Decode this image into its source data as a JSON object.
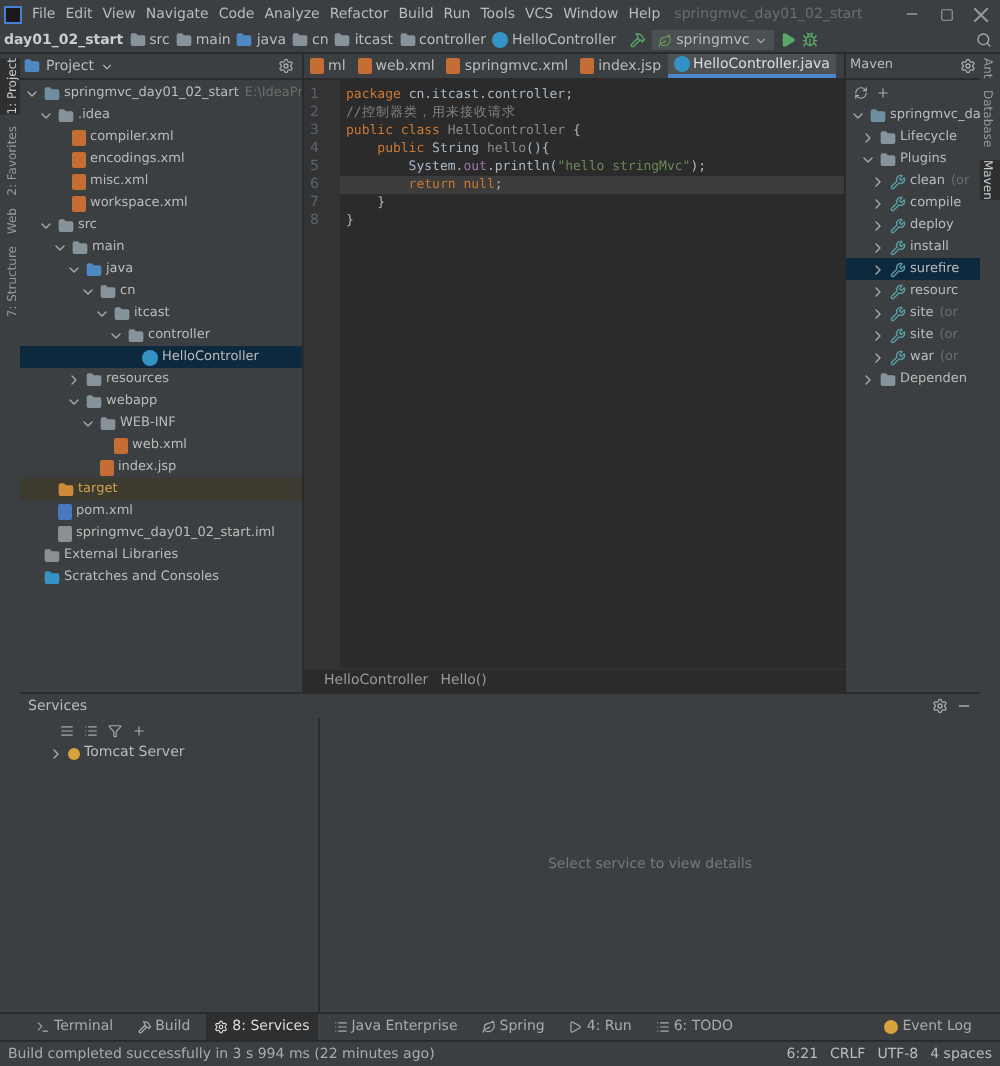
{
  "menu": [
    "File",
    "Edit",
    "View",
    "Navigate",
    "Code",
    "Analyze",
    "Refactor",
    "Build",
    "Run",
    "Tools",
    "VCS",
    "Window",
    "Help"
  ],
  "window": {
    "title": "springmvc_day01_02_start"
  },
  "breadcrumbs": [
    {
      "label": "day01_02_start",
      "kind": "project"
    },
    {
      "label": "src",
      "kind": "folder"
    },
    {
      "label": "main",
      "kind": "folder"
    },
    {
      "label": "java",
      "kind": "source"
    },
    {
      "label": "cn",
      "kind": "folder"
    },
    {
      "label": "itcast",
      "kind": "folder"
    },
    {
      "label": "controller",
      "kind": "folder"
    },
    {
      "label": "HelloController",
      "kind": "class"
    }
  ],
  "run_config": "springmvc",
  "project_header": "Project",
  "tabs": [
    {
      "label": "ml",
      "kind": "xml",
      "selected": false
    },
    {
      "label": "web.xml",
      "kind": "xml",
      "selected": false
    },
    {
      "label": "springmvc.xml",
      "kind": "xml",
      "selected": false
    },
    {
      "label": "index.jsp",
      "kind": "jsp",
      "selected": false
    },
    {
      "label": "HelloController.java",
      "kind": "class",
      "selected": true
    }
  ],
  "tree": [
    {
      "label": "springmvc_day01_02_start",
      "hint": "E:\\IdeaPr",
      "kind": "module",
      "expanded": true,
      "selected": false,
      "children": [
        {
          "label": ".idea",
          "kind": "folder",
          "expanded": true,
          "selected": false,
          "children": [
            {
              "label": "compiler.xml",
              "kind": "xml",
              "selected": false
            },
            {
              "label": "encodings.xml",
              "kind": "xml",
              "selected": false
            },
            {
              "label": "misc.xml",
              "kind": "xml",
              "selected": false
            },
            {
              "label": "workspace.xml",
              "kind": "xml",
              "selected": false
            }
          ]
        },
        {
          "label": "src",
          "kind": "folder",
          "expanded": true,
          "selected": false,
          "children": [
            {
              "label": "main",
              "kind": "folder",
              "expanded": true,
              "selected": false,
              "children": [
                {
                  "label": "java",
                  "kind": "source",
                  "expanded": true,
                  "selected": false,
                  "children": [
                    {
                      "label": "cn",
                      "kind": "folder",
                      "expanded": true,
                      "selected": false,
                      "children": [
                        {
                          "label": "itcast",
                          "kind": "folder",
                          "expanded": true,
                          "selected": false,
                          "children": [
                            {
                              "label": "controller",
                              "kind": "folder",
                              "expanded": true,
                              "selected": false,
                              "children": [
                                {
                                  "label": "HelloController",
                                  "kind": "class",
                                  "selected": true
                                }
                              ]
                            }
                          ]
                        }
                      ]
                    }
                  ]
                },
                {
                  "label": "resources",
                  "kind": "folder",
                  "expanded": false,
                  "selected": false
                },
                {
                  "label": "webapp",
                  "kind": "folder",
                  "expanded": true,
                  "selected": false,
                  "children": [
                    {
                      "label": "WEB-INF",
                      "kind": "folder",
                      "expanded": true,
                      "selected": false,
                      "children": [
                        {
                          "label": "web.xml",
                          "kind": "xml",
                          "selected": false
                        }
                      ]
                    },
                    {
                      "label": "index.jsp",
                      "kind": "jsp",
                      "selected": false
                    }
                  ]
                }
              ]
            }
          ]
        },
        {
          "label": "target",
          "kind": "excluded",
          "selected": false
        },
        {
          "label": "pom.xml",
          "kind": "pom",
          "selected": false
        },
        {
          "label": "springmvc_day01_02_start.iml",
          "kind": "iml",
          "selected": false
        }
      ]
    },
    {
      "label": "External Libraries",
      "kind": "library",
      "selected": false
    },
    {
      "label": "Scratches and Consoles",
      "kind": "scratch",
      "selected": false
    }
  ],
  "code": [
    {
      "current": false,
      "tokens": [
        {
          "text": "package ",
          "kind": "kw"
        },
        {
          "text": "cn.itcast.controller;",
          "kind": "plain"
        }
      ]
    },
    {
      "current": false,
      "tokens": [
        {
          "text": "//控制器类，用来接收请求",
          "kind": "comment"
        }
      ]
    },
    {
      "current": false,
      "tokens": [
        {
          "text": "public class ",
          "kind": "kw"
        },
        {
          "text": "HelloController ",
          "kind": "dim"
        },
        {
          "text": "{",
          "kind": "plain"
        }
      ]
    },
    {
      "current": false,
      "tokens": [
        {
          "text": "    public ",
          "kind": "kw"
        },
        {
          "text": "String ",
          "kind": "plain"
        },
        {
          "text": "hello",
          "kind": "dim"
        },
        {
          "text": "(){",
          "kind": "plain"
        }
      ]
    },
    {
      "current": false,
      "tokens": [
        {
          "text": "        System.",
          "kind": "plain"
        },
        {
          "text": "out",
          "kind": "field"
        },
        {
          "text": ".println(",
          "kind": "plain"
        },
        {
          "text": "\"hello stringMvc\"",
          "kind": "str"
        },
        {
          "text": ");",
          "kind": "plain"
        }
      ]
    },
    {
      "current": true,
      "tokens": [
        {
          "text": "        return null",
          "kind": "kw"
        },
        {
          "text": ";",
          "kind": "plain"
        }
      ]
    },
    {
      "current": false,
      "tokens": [
        {
          "text": "    }",
          "kind": "plain"
        }
      ]
    },
    {
      "current": false,
      "tokens": [
        {
          "text": "}",
          "kind": "plain"
        }
      ]
    }
  ],
  "line_numbers": [
    "1",
    "2",
    "3",
    "4",
    "5",
    "6",
    "7",
    "8"
  ],
  "editor_breadcrumbs": [
    "HelloController",
    "Hello()"
  ],
  "maven": {
    "title": "Maven",
    "tree": [
      {
        "label": "springmvc_da",
        "kind": "module",
        "expanded": true,
        "selected": false,
        "children": [
          {
            "label": "Lifecycle",
            "kind": "folder",
            "expanded": false,
            "selected": false
          },
          {
            "label": "Plugins",
            "kind": "folder",
            "expanded": true,
            "selected": false,
            "children": [
              {
                "label": "clean",
                "hint": "(or",
                "kind": "plugin",
                "expanded": false,
                "selected": false
              },
              {
                "label": "compile",
                "kind": "plugin",
                "expanded": false,
                "selected": false
              },
              {
                "label": "deploy",
                "kind": "plugin",
                "expanded": false,
                "selected": false
              },
              {
                "label": "install",
                "kind": "plugin",
                "expanded": false,
                "selected": false
              },
              {
                "label": "surefire",
                "kind": "plugin",
                "expanded": false,
                "selected": true
              },
              {
                "label": "resourc",
                "kind": "plugin",
                "expanded": false,
                "selected": false
              },
              {
                "label": "site",
                "hint": "(or",
                "kind": "plugin",
                "expanded": false,
                "selected": false
              },
              {
                "label": "site",
                "hint": "(or",
                "kind": "plugin",
                "expanded": false,
                "selected": false
              },
              {
                "label": "war",
                "hint": "(or",
                "kind": "plugin",
                "expanded": false,
                "selected": false
              }
            ]
          },
          {
            "label": "Dependen",
            "kind": "folder",
            "expanded": false,
            "selected": false
          }
        ]
      }
    ]
  },
  "left_strip": [
    {
      "label": "1: Project",
      "selected": true
    },
    {
      "label": "2: Favorites",
      "selected": false
    },
    {
      "label": "Web",
      "selected": false
    },
    {
      "label": "7: Structure",
      "selected": false
    }
  ],
  "right_strip": [
    {
      "label": "Ant",
      "selected": false
    },
    {
      "label": "Database",
      "selected": false
    },
    {
      "label": "Maven",
      "selected": true
    }
  ],
  "services": {
    "title": "Services",
    "items": [
      {
        "label": "Tomcat Server",
        "expanded": false
      }
    ],
    "empty": "Select service to view details"
  },
  "tool_windows": [
    {
      "label": "Terminal",
      "kind": "terminal",
      "selected": false
    },
    {
      "label": "Build",
      "kind": "build",
      "selected": false
    },
    {
      "label": "8: Services",
      "kind": "services",
      "selected": true
    },
    {
      "label": "Java Enterprise",
      "kind": "enterprise",
      "selected": false
    },
    {
      "label": "Spring",
      "kind": "spring",
      "selected": false
    },
    {
      "label": "4: Run",
      "kind": "run",
      "selected": false
    },
    {
      "label": "6: TODO",
      "kind": "todo",
      "selected": false
    }
  ],
  "event_log": "Event Log",
  "status": {
    "message": "Build completed successfully in 3 s 994 ms (22 minutes ago)",
    "position": "6:21",
    "line_sep": "CRLF",
    "encoding": "UTF-8",
    "indent": "4 spaces"
  }
}
